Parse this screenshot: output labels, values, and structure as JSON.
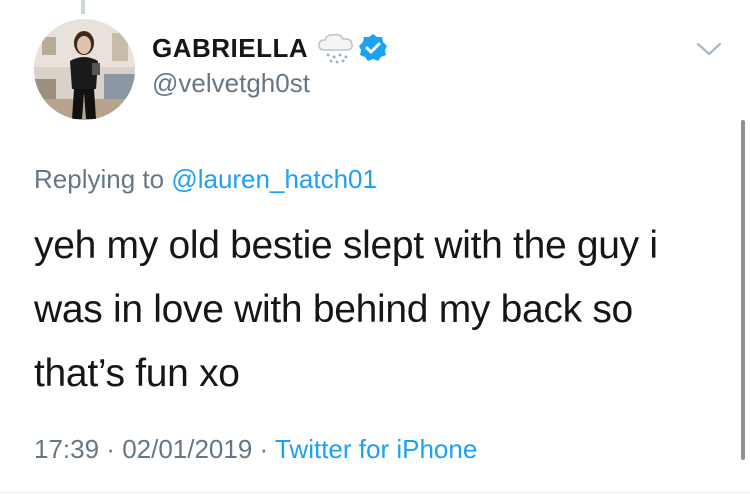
{
  "author": {
    "display_name": "GABRIELLA",
    "handle": "@velvetgh0st",
    "name_emoji": "snow-cloud-icon",
    "verified_icon": "verified-badge-icon"
  },
  "reply": {
    "prefix": "Replying to ",
    "target": "@lauren_hatch01"
  },
  "tweet": {
    "text_lines": [
      "yeh my old bestie slept with the guy i",
      "was in love with behind my back so",
      "that’s fun xo"
    ]
  },
  "meta": {
    "time": "17:39",
    "sep1": " · ",
    "date": "02/01/2019",
    "sep2": " · ",
    "source": "Twitter for iPhone"
  },
  "colors": {
    "link": "#1da1f2",
    "secondary": "#657786",
    "primary": "#14171a"
  }
}
